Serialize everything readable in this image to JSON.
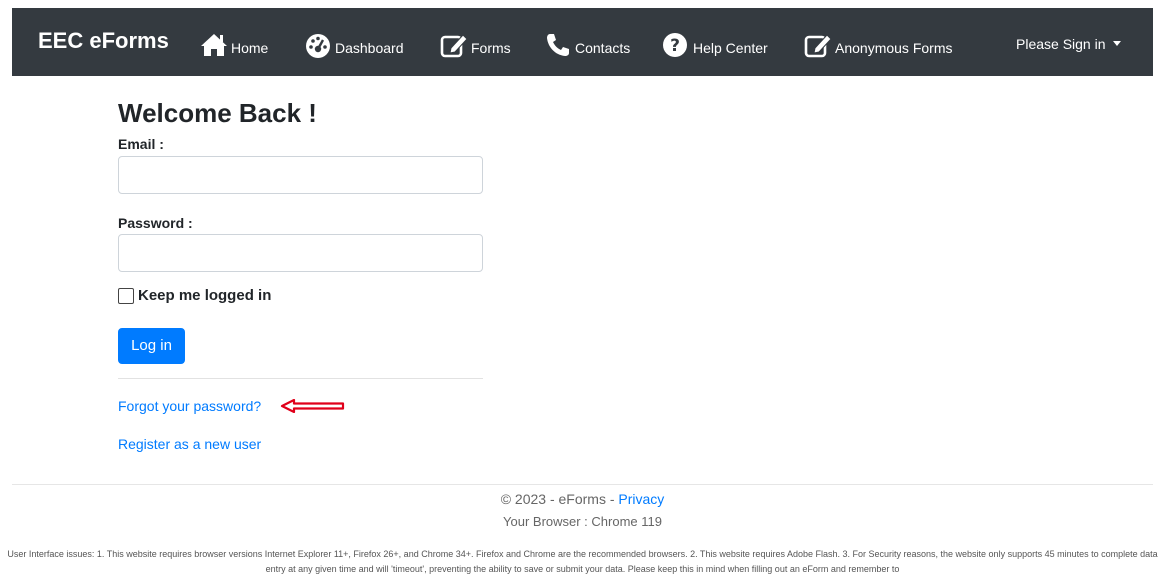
{
  "nav": {
    "brand": "EEC eForms",
    "items": [
      {
        "label": "Home",
        "icon": "home-icon"
      },
      {
        "label": "Dashboard",
        "icon": "dashboard-gauge-icon"
      },
      {
        "label": "Forms",
        "icon": "edit-form-icon"
      },
      {
        "label": "Contacts",
        "icon": "phone-icon"
      },
      {
        "label": "Help Center",
        "icon": "question-circle-icon"
      },
      {
        "label": "Anonymous Forms",
        "icon": "edit-form-icon"
      }
    ],
    "signin": "Please Sign in"
  },
  "login": {
    "title": "Welcome Back !",
    "email_label": "Email :",
    "email_value": "",
    "password_label": "Password :",
    "password_value": "",
    "remember_label": "Keep me logged in",
    "remember_checked": false,
    "submit_label": "Log in",
    "forgot_link": "Forgot your password?",
    "register_link": "Register as a new user"
  },
  "annotation": {
    "arrow_color": "#e0001a"
  },
  "footer": {
    "copyright": "© 2023 - eForms -",
    "privacy_link": "Privacy",
    "browser": "Your Browser : Chrome 119",
    "notice": "User Interface issues: 1. This website requires browser versions Internet Explorer 11+, Firefox 26+, and Chrome 34+. Firefox and Chrome are the recommended browsers. 2. This website requires Adobe Flash. 3. For Security reasons, the website only supports 45 minutes to complete data entry at any given time and will 'timeout', preventing the ability to save or submit your data. Please keep this in mind when filling out an eForm and remember to"
  },
  "colors": {
    "navbar": "#343a40",
    "primary": "#007bff",
    "link": "#007bff"
  }
}
